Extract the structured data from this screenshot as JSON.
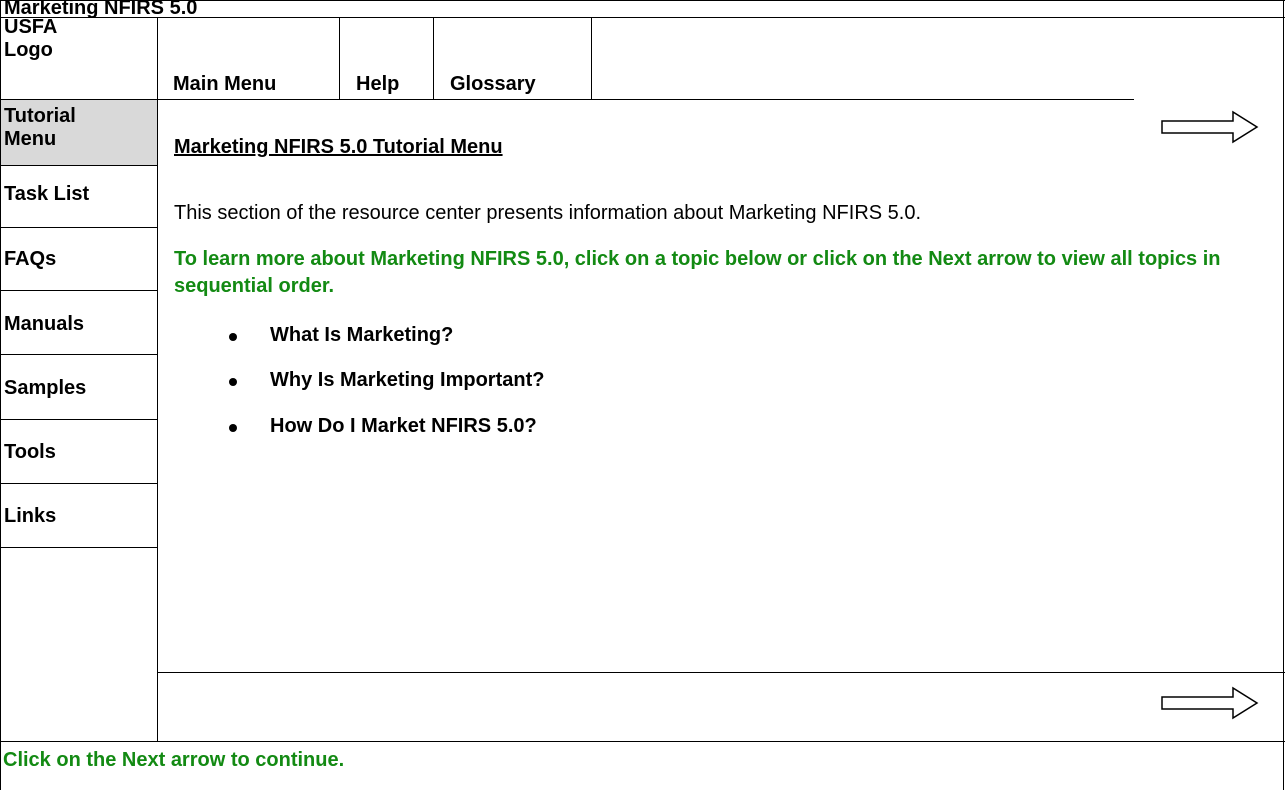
{
  "window": {
    "title": "Marketing NFIRS 5.0"
  },
  "header": {
    "logo_line1": "USFA",
    "logo_line2": "Logo",
    "nav": [
      {
        "label": "Main Menu"
      },
      {
        "label": "Help"
      },
      {
        "label": "Glossary"
      }
    ]
  },
  "sidebar": {
    "active_line1": "Tutorial",
    "active_line2": "Menu",
    "items": [
      {
        "label": "Task List"
      },
      {
        "label": "FAQs"
      },
      {
        "label": "Manuals"
      },
      {
        "label": "Samples"
      },
      {
        "label": "Tools"
      },
      {
        "label": "Links"
      }
    ]
  },
  "content": {
    "heading": "Marketing NFIRS 5.0 Tutorial Menu",
    "intro": "This section of the resource center presents information about Marketing NFIRS 5.0.",
    "instruction": "To learn more about Marketing NFIRS 5.0, click on a topic below or click on the Next arrow to view all topics in sequential order.",
    "topics": [
      {
        "label": "What Is Marketing?"
      },
      {
        "label": "Why Is Marketing Important?"
      },
      {
        "label": "How Do I Market NFIRS 5.0?"
      }
    ]
  },
  "footer": {
    "note": "Click on the Next arrow to continue."
  },
  "icons": {
    "next": "next-arrow-icon"
  },
  "colors": {
    "green_text": "#138a13",
    "active_sidebar_bg": "#d9d9d9"
  }
}
